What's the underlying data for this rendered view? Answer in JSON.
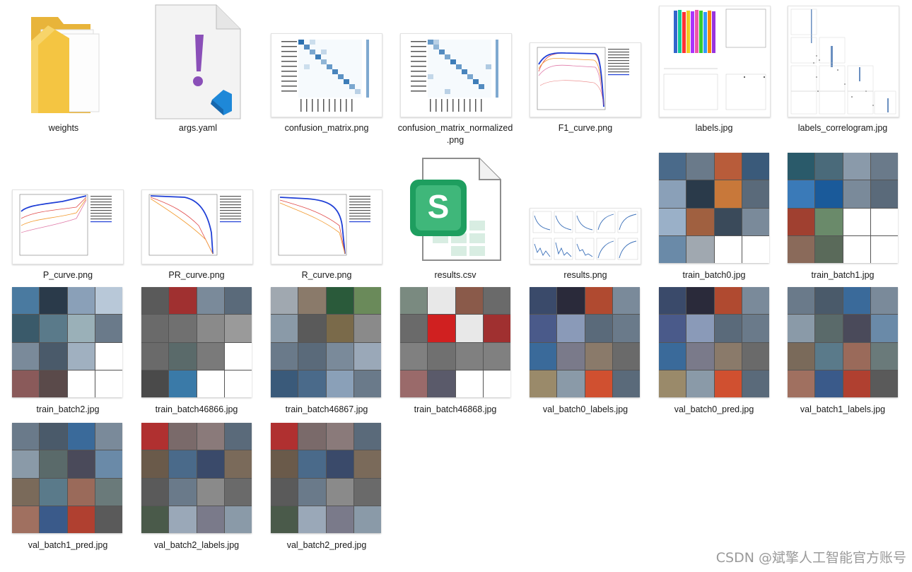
{
  "files": [
    {
      "name": "weights",
      "kind": "folder"
    },
    {
      "name": "args.yaml",
      "kind": "yaml"
    },
    {
      "name": "confusion_matrix.png",
      "kind": "matrix"
    },
    {
      "name": "confusion_matrix_normalized.png",
      "kind": "matrix"
    },
    {
      "name": "F1_curve.png",
      "kind": "curve"
    },
    {
      "name": "labels.jpg",
      "kind": "labels"
    },
    {
      "name": "labels_correlogram.jpg",
      "kind": "correlogram"
    },
    {
      "name": "P_curve.png",
      "kind": "curve"
    },
    {
      "name": "PR_curve.png",
      "kind": "curve"
    },
    {
      "name": "R_curve.png",
      "kind": "curve"
    },
    {
      "name": "results.csv",
      "kind": "csv"
    },
    {
      "name": "results.png",
      "kind": "results"
    },
    {
      "name": "train_batch0.jpg",
      "kind": "mosaic"
    },
    {
      "name": "train_batch1.jpg",
      "kind": "mosaic"
    },
    {
      "name": "train_batch2.jpg",
      "kind": "mosaic"
    },
    {
      "name": "train_batch46866.jpg",
      "kind": "mosaic"
    },
    {
      "name": "train_batch46867.jpg",
      "kind": "mosaic"
    },
    {
      "name": "train_batch46868.jpg",
      "kind": "mosaic"
    },
    {
      "name": "val_batch0_labels.jpg",
      "kind": "mosaic"
    },
    {
      "name": "val_batch0_pred.jpg",
      "kind": "mosaic"
    },
    {
      "name": "val_batch1_labels.jpg",
      "kind": "mosaic"
    },
    {
      "name": "val_batch1_pred.jpg",
      "kind": "mosaic"
    },
    {
      "name": "val_batch2_labels.jpg",
      "kind": "mosaic"
    },
    {
      "name": "val_batch2_pred.jpg",
      "kind": "mosaic"
    }
  ],
  "label_lines": {
    "confusion_matrix_normalized_1": "confusion_matrix_normalized",
    "confusion_matrix_normalized_2": ".png"
  },
  "csv_letter": "S",
  "yaml_mark": "!",
  "watermark": "CSDN @斌擎人工智能官方账号",
  "colors": {
    "folder": "#f4c542",
    "yaml_purple": "#8a4fb8",
    "vscode_blue": "#1e88d8",
    "csv_green": "#1e9e5f",
    "matrix_blue": "#2a6fb0",
    "curve_blue": "#1f3fd6"
  }
}
